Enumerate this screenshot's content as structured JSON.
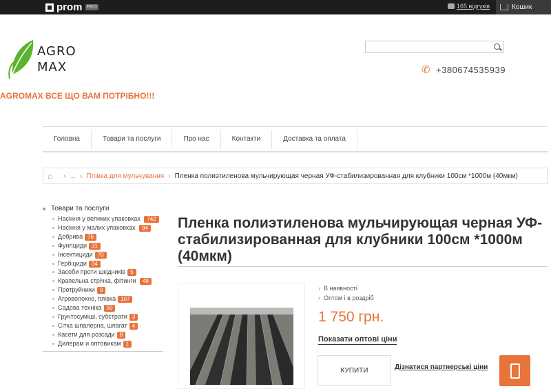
{
  "topbar": {
    "brand": "prom",
    "brand_badge": "PRO",
    "reviews_link": "165 відгуків",
    "cart_label": "Кошик"
  },
  "header": {
    "logo_line1": "AGRO",
    "logo_line2": "MAX",
    "search_placeholder": "",
    "phone": "+380674535939",
    "slogan": "AGROMAX ВСЕ ЩО ВАМ ПОТРІБНО!!!"
  },
  "nav": {
    "items": [
      "Головна",
      "Товари та послуги",
      "Про нас",
      "Контакти",
      "Доставка та оплата"
    ]
  },
  "breadcrumb": {
    "dots": "...",
    "category": "Плівка для мульчування",
    "current": "Пленка полиэтиленова мульчирующая черная УФ-стабилизированная для клубники 100см *1000м (40мкм)"
  },
  "sidebar": {
    "root": "Товари та послуги",
    "items": [
      {
        "label": "Насіння у великих упаковках",
        "count": "742"
      },
      {
        "label": "Насіння у малих упаковках",
        "count": "94"
      },
      {
        "label": "Добрива",
        "count": "76"
      },
      {
        "label": "Фунгіциди",
        "count": "31"
      },
      {
        "label": "Інсектициди",
        "count": "70"
      },
      {
        "label": "Гербіциди",
        "count": "34"
      },
      {
        "label": "Засоби проти шкідників",
        "count": "5"
      },
      {
        "label": "Крапельна стрічка, фітинги",
        "count": "48"
      },
      {
        "label": "Протруйники",
        "count": "9"
      },
      {
        "label": "Агроволокно, плівка",
        "count": "107"
      },
      {
        "label": "Садова техніка",
        "count": "50"
      },
      {
        "label": "Грунтосуміші, субстрати",
        "count": "3"
      },
      {
        "label": "Сітка шпалерна, шпагат",
        "count": "4"
      },
      {
        "label": "Касети для розсади",
        "count": "8"
      },
      {
        "label": "Дилерам и оптовикам",
        "count": "1"
      }
    ]
  },
  "product": {
    "title": "Пленка полиэтиленова мульчирующая черная УФ-стабилизированная для клубники 100см *1000м (40мкм)",
    "availability": "В наявності",
    "sale_type": "Оптом і в роздріб",
    "price": "1 750 грн.",
    "wholesale_link": "Показати оптові ціни",
    "buy_button": "КУПИТИ",
    "partner_link": "Дізнатися партнерські ціни"
  },
  "colors": {
    "accent": "#e8743b",
    "topbar": "#1d1d1d",
    "logo_green": "#5cb32e"
  }
}
